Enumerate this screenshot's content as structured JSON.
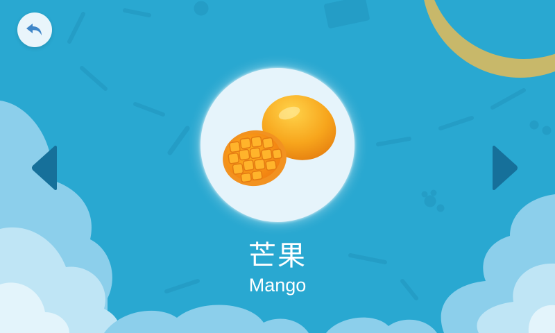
{
  "screen": {
    "back_icon": "undo-arrow-icon",
    "prev_icon": "chevron-left-triangle",
    "next_icon": "chevron-right-triangle"
  },
  "item": {
    "name_cn": "芒果",
    "name_en": "Mango",
    "image": "mango-illustration"
  },
  "colors": {
    "background": "#29a8d1",
    "moon": "#c8b86a",
    "cloud": "#8fd0ec",
    "arrow": "#16709a",
    "card": "#e6f4fb",
    "text": "#ffffff"
  }
}
